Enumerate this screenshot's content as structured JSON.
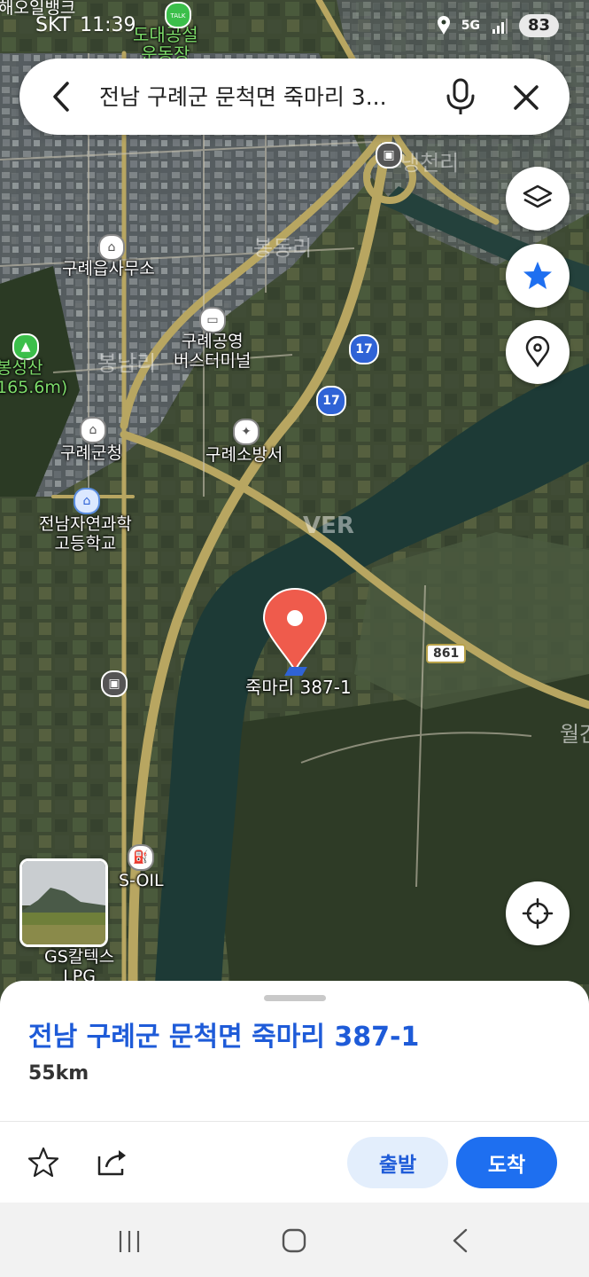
{
  "status_bar": {
    "carrier": "SKT",
    "time": "11:39",
    "network": "5G",
    "battery": "83"
  },
  "search": {
    "query": "전남 구례군 문척면 죽마리 3..."
  },
  "map": {
    "pin_label": "죽마리 387-1",
    "labels": {
      "top_left_cut": "해오일뱅크",
      "top_cut": "도대공설\n운동장",
      "village_1": "냉천리",
      "village_2": "봉동리",
      "village_3": "봉남리",
      "office": "구례읍사무소",
      "terminal": "구례공영\n버스터미널",
      "mountain": "봉성산\n165.6m)",
      "county_office": "구례군청",
      "fire_station": "구례소방서",
      "school": "전남자연과학\n고등학교",
      "gas_1": "S-OIL",
      "gas_2": "GS칼텍스\nLPG",
      "right_cut": "월간",
      "watermark": "VER"
    },
    "route_numbers": [
      "17",
      "17"
    ],
    "road_number": "861",
    "talk_badge": "TALK"
  },
  "sheet": {
    "title": "전남 구례군 문척면 죽마리 387-1",
    "distance": "55km",
    "depart_label": "출발",
    "arrive_label": "도착"
  },
  "colors": {
    "accent": "#1e6ff0",
    "pin": "#ef5b4c",
    "star": "#1e6ff0"
  }
}
